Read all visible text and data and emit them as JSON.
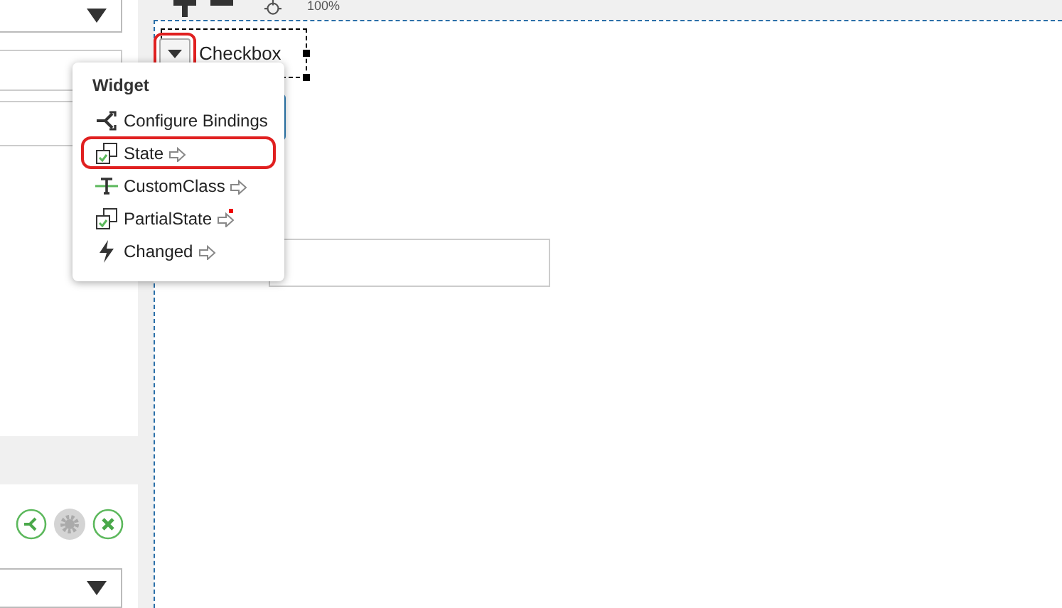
{
  "toolbar": {
    "zoom": "100%"
  },
  "canvas": {
    "widget": {
      "label": "Checkbox",
      "menu_open": true
    }
  },
  "menu": {
    "title": "Widget",
    "items": [
      {
        "label": "Configure Bindings",
        "kind": "bindings",
        "submenu": false,
        "modified": false,
        "selected": false
      },
      {
        "label": "State",
        "kind": "state",
        "submenu": true,
        "modified": false,
        "selected": true
      },
      {
        "label": "CustomClass",
        "kind": "customclass",
        "submenu": true,
        "modified": false,
        "selected": false
      },
      {
        "label": "PartialState",
        "kind": "state",
        "submenu": true,
        "modified": true,
        "selected": false
      },
      {
        "label": "Changed",
        "kind": "changed",
        "submenu": true,
        "modified": false,
        "selected": false
      }
    ]
  }
}
